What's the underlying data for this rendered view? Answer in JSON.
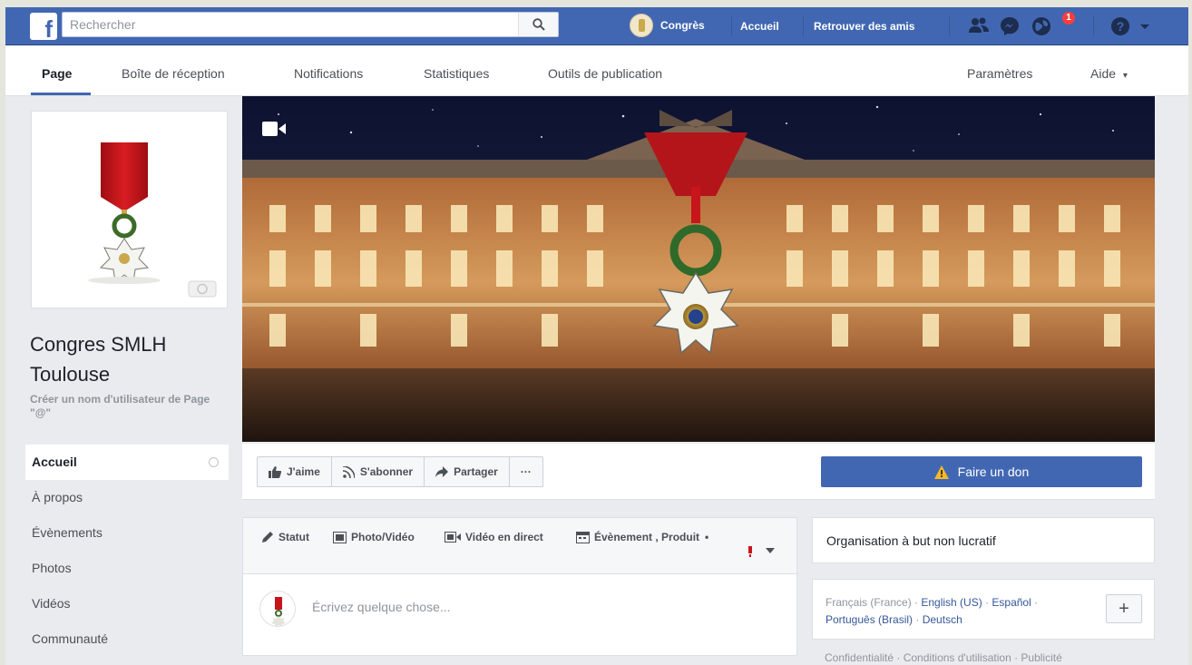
{
  "topbar": {
    "logo_letter": "f",
    "search_placeholder": "Rechercher",
    "profile_name": "Congrès",
    "home_label": "Accueil",
    "find_friends_label": "Retrouver des amis",
    "notification_count": "1"
  },
  "pagenav": {
    "tabs": [
      {
        "label": "Page"
      },
      {
        "label": "Boîte de réception"
      },
      {
        "label": "Notifications"
      },
      {
        "label": "Statistiques"
      },
      {
        "label": "Outils de publication"
      }
    ],
    "settings_label": "Paramètres",
    "help_label": "Aide",
    "help_caret": "▾"
  },
  "page": {
    "name": "Congres SMLH Toulouse",
    "username_prompt": "Créer un nom d'utilisateur de Page \"@\""
  },
  "sidenav": {
    "items": [
      {
        "label": "Accueil"
      },
      {
        "label": "À propos"
      },
      {
        "label": "Évènements"
      },
      {
        "label": "Photos"
      },
      {
        "label": "Vidéos"
      },
      {
        "label": "Communauté"
      }
    ]
  },
  "actions": {
    "like": "J'aime",
    "follow": "S'abonner",
    "share": "Partager",
    "more": "···",
    "donate": "Faire un don"
  },
  "composer": {
    "status": "Statut",
    "photo_video": "Photo/Vidéo",
    "live_video": "Vidéo en direct",
    "event_product": "Évènement , Produit",
    "more_dot": "•",
    "placeholder": "Écrivez quelque chose..."
  },
  "right": {
    "category": "Organisation à but non lucratif",
    "languages": {
      "current": "Français (France)",
      "sep": " · ",
      "links": [
        "English (US)",
        "Español",
        "Português (Brasil)",
        "Deutsch"
      ]
    },
    "add_label": "+",
    "footer": "Confidentialité · Conditions d'utilisation · Publicité"
  },
  "colors": {
    "facebook_blue": "#4267b2",
    "ribbon_red": "#c8151b",
    "link_blue": "#365899",
    "badge_red": "#fa3e3e"
  }
}
